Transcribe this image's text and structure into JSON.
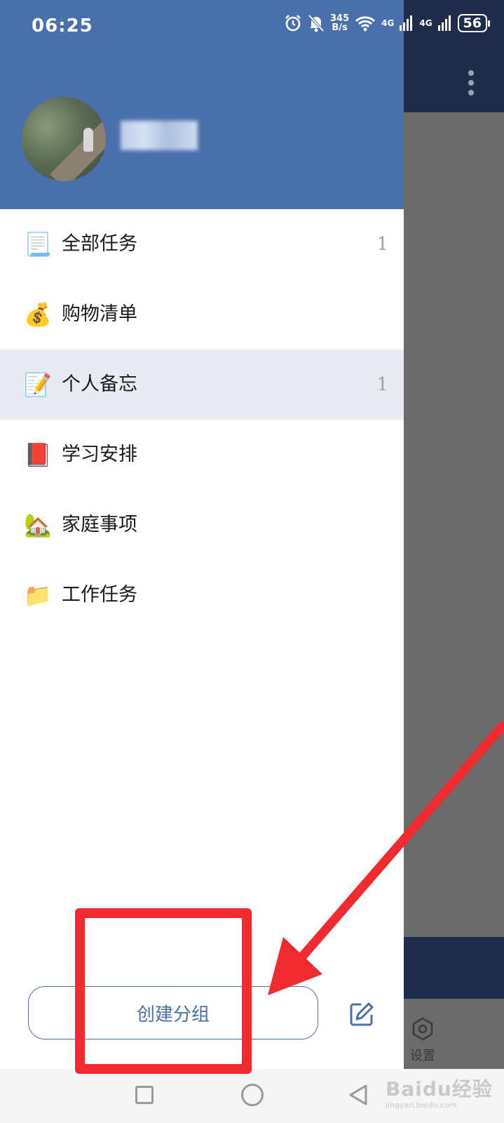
{
  "status_bar": {
    "time": "06:25",
    "net_speed_value": "345",
    "net_speed_unit": "B/s",
    "signal_1": "4G",
    "signal_2": "4G",
    "battery": "56"
  },
  "background_app": {
    "settings_label": "设置",
    "menu_icon": "more-vertical-icon",
    "settings_icon": "gear-icon"
  },
  "drawer": {
    "header_color": "#4a6fad",
    "avatar_icon": "user-avatar-photo",
    "groups": [
      {
        "icon": "scroll-icon",
        "emoji": "📃",
        "label": "全部任务",
        "count": "1",
        "selected": false
      },
      {
        "icon": "money-bag-icon",
        "emoji": "💰",
        "label": "购物清单",
        "count": "",
        "selected": false
      },
      {
        "icon": "memo-icon",
        "emoji": "📝",
        "label": "个人备忘",
        "count": "1",
        "selected": true
      },
      {
        "icon": "book-icon",
        "emoji": "📕",
        "label": "学习安排",
        "count": "",
        "selected": false
      },
      {
        "icon": "house-icon",
        "emoji": "🏡",
        "label": "家庭事项",
        "count": "",
        "selected": false
      },
      {
        "icon": "folder-icon",
        "emoji": "📁",
        "label": "工作任务",
        "count": "",
        "selected": false
      }
    ],
    "create_group_label": "创建分组",
    "edit_icon": "edit-icon"
  },
  "watermark": {
    "text": "Baidu经验",
    "sub": "jingyan.baidu.com"
  },
  "annotation": {
    "color": "#f02a2f"
  }
}
